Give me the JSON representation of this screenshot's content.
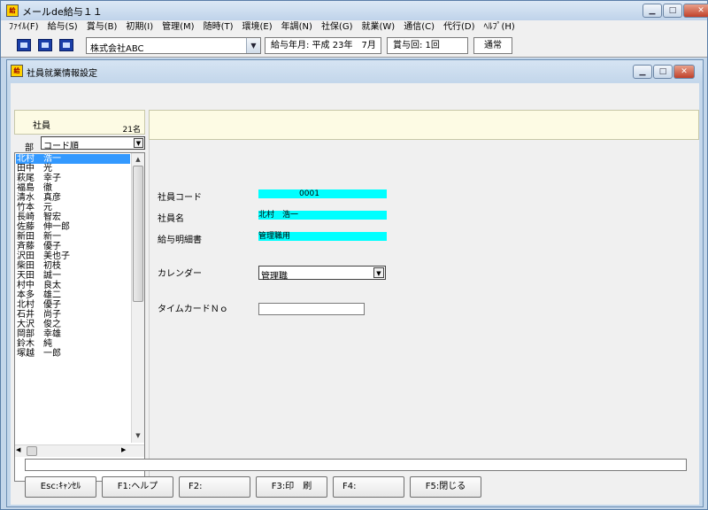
{
  "app": {
    "title": "メールde給与１１",
    "colors": {
      "selection": "#3399ff",
      "highlight_field": "#00ffff",
      "info_panel": "#fdfbe4"
    }
  },
  "menu": [
    "ﾌｧｲﾙ(F)",
    "給与(S)",
    "賞与(B)",
    "初期(I)",
    "管理(M)",
    "随時(T)",
    "環境(E)",
    "年調(N)",
    "社保(G)",
    "就業(W)",
    "通信(C)",
    "代行(D)",
    "ﾍﾙﾌﾟ(H)"
  ],
  "toolbar": {
    "icons": [
      "save-icon",
      "mail-send-icon",
      "mail-receive-icon"
    ],
    "company": "株式会社ABC",
    "pay_month": "給与年月: 平成 23年　7月",
    "bonus_count": "賞与回: 1回",
    "mode": "通常"
  },
  "child": {
    "title": "社員就業情報設定",
    "employee_header": {
      "label": "社員",
      "count": "21名"
    },
    "dept_label": "部",
    "sort_selected": "コード順",
    "employees": [
      "北村　浩一",
      "田中　光",
      "萩尾　幸子",
      "福島　徹",
      "清水　真彦",
      "竹本　元",
      "長崎　智宏",
      "佐藤　伸一郎",
      "新田　新一",
      "斉藤　優子",
      "沢田　美也子",
      "柴田　初枝",
      "天田　誠一",
      "村中　良太",
      "本多　雄二",
      "北村　優子",
      "石井　尚子",
      "大沢　俊之",
      "岡部　幸雄",
      "鈴木　純",
      "塚越　一郎"
    ],
    "selected_index": 0,
    "form": {
      "code_label": "社員コード",
      "code_value": "0001",
      "name_label": "社員名",
      "name_value": "北村　浩一",
      "payslip_label": "給与明細書",
      "payslip_value": "管理職用",
      "calendar_label": "カレンダー",
      "calendar_value": "管理職",
      "timecard_label": "タイムカードＮｏ",
      "timecard_value": ""
    },
    "status_text": "",
    "buttons": [
      "Esc:ｷｬﾝｾﾙ",
      "F1:ヘルプ",
      "F2:",
      "F3:印　刷",
      "F4:",
      "F5:閉じる"
    ]
  }
}
